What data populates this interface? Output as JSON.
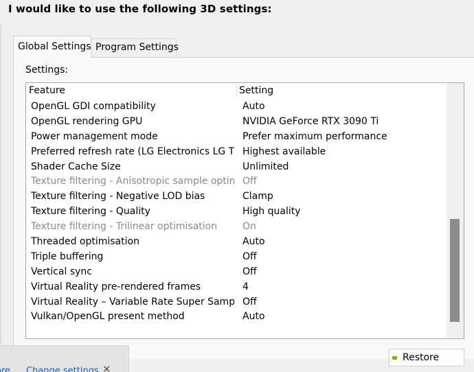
{
  "header": {
    "title": "I would like to use the following 3D settings:"
  },
  "tabs": [
    {
      "label": "Global Settings",
      "selected": true
    },
    {
      "label": "Program Settings",
      "selected": false
    }
  ],
  "settings_label": "Settings:",
  "table": {
    "columns": [
      "Feature",
      "Setting"
    ],
    "rows": [
      {
        "feature": "OpenGL GDI compatibility",
        "value": "Auto",
        "enabled": true
      },
      {
        "feature": "OpenGL rendering GPU",
        "value": "NVIDIA GeForce RTX 3090 Ti",
        "enabled": true
      },
      {
        "feature": "Power management mode",
        "value": "Prefer maximum performance",
        "enabled": true
      },
      {
        "feature": "Preferred refresh rate (LG Electronics LG TV...",
        "value": "Highest available",
        "enabled": true
      },
      {
        "feature": "Shader Cache Size",
        "value": "Unlimited",
        "enabled": true
      },
      {
        "feature": "Texture filtering - Anisotropic sample optimi...",
        "value": "Off",
        "enabled": false
      },
      {
        "feature": "Texture filtering - Negative LOD bias",
        "value": "Clamp",
        "enabled": true
      },
      {
        "feature": "Texture filtering - Quality",
        "value": "High quality",
        "enabled": true
      },
      {
        "feature": "Texture filtering - Trilinear optimisation",
        "value": "On",
        "enabled": false
      },
      {
        "feature": "Threaded optimisation",
        "value": "Auto",
        "enabled": true
      },
      {
        "feature": "Triple buffering",
        "value": "Off",
        "enabled": true
      },
      {
        "feature": "Vertical sync",
        "value": "Off",
        "enabled": true
      },
      {
        "feature": "Virtual Reality pre-rendered frames",
        "value": "4",
        "enabled": true
      },
      {
        "feature": "Virtual Reality – Variable Rate Super Sampling",
        "value": "Off",
        "enabled": true
      },
      {
        "feature": "Vulkan/OpenGL present method",
        "value": "Auto",
        "enabled": true
      }
    ]
  },
  "restore_button": {
    "label": "Restore"
  },
  "notification": {
    "link_partial": "ore",
    "change_settings": "Change settings",
    "close_glyph": "✕"
  },
  "icons": {
    "restore": "nvidia-logo-icon",
    "close": "close-icon"
  },
  "colors": {
    "nvidia_green": "#76b900",
    "disabled_text": "#8a8a8a",
    "link": "#1a5fb4"
  }
}
